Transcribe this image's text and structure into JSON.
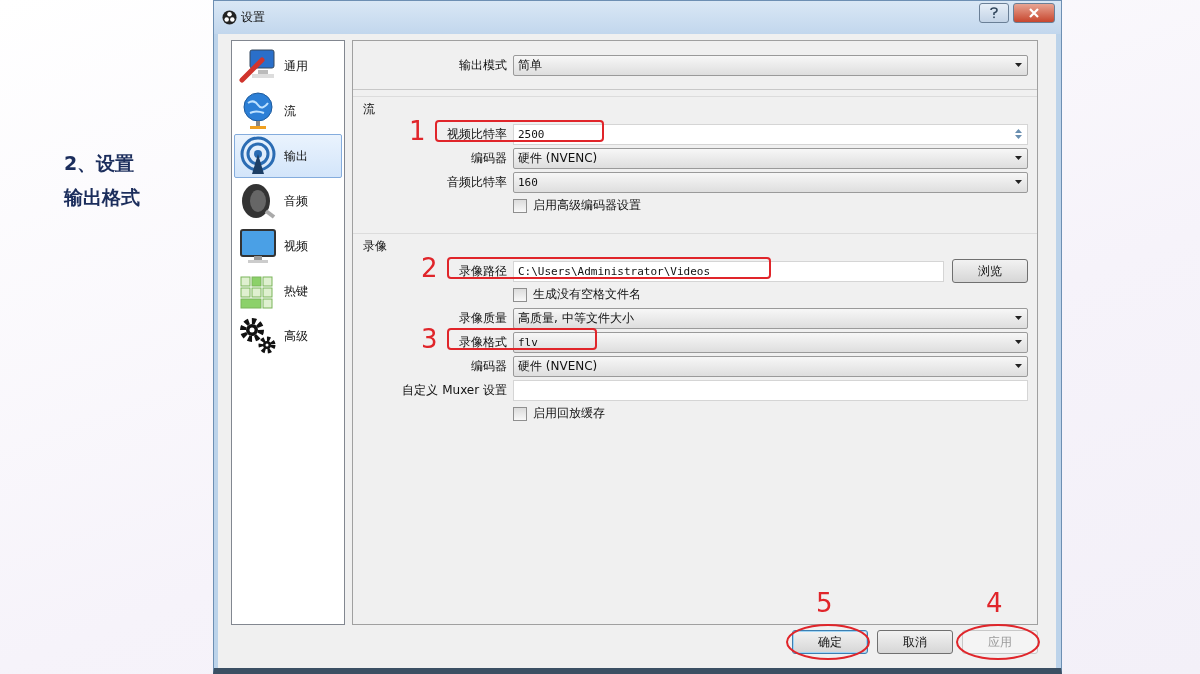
{
  "slide": {
    "caption_lines": [
      "2、设置",
      "输出格式"
    ]
  },
  "window": {
    "title": "设置"
  },
  "sidebar": {
    "items": [
      {
        "label": "通用",
        "kind": "general",
        "selected": false
      },
      {
        "label": "流",
        "kind": "stream",
        "selected": false
      },
      {
        "label": "输出",
        "kind": "output",
        "selected": true
      },
      {
        "label": "音频",
        "kind": "audio",
        "selected": false
      },
      {
        "label": "视频",
        "kind": "video",
        "selected": false
      },
      {
        "label": "热键",
        "kind": "hotkeys",
        "selected": false
      },
      {
        "label": "高级",
        "kind": "advanced",
        "selected": false
      }
    ]
  },
  "output_mode": {
    "label": "输出模式",
    "value": "简单"
  },
  "groups": [
    {
      "title": "流",
      "rows": [
        {
          "kind": "spin",
          "label": "视频比特率",
          "value": "2500",
          "marker": "1"
        },
        {
          "kind": "combo",
          "label": "编码器",
          "value": "硬件 (NVENC)"
        },
        {
          "kind": "combo",
          "label": "音频比特率",
          "value": "160"
        },
        {
          "kind": "checkbox",
          "label": "启用高级编码器设置",
          "checked": false
        }
      ]
    },
    {
      "title": "录像",
      "rows": [
        {
          "kind": "path",
          "label": "录像路径",
          "value": "C:\\Users\\Administrator\\Videos",
          "button": "浏览",
          "marker": "2"
        },
        {
          "kind": "checkbox",
          "label": "生成没有空格文件名",
          "checked": false
        },
        {
          "kind": "combo",
          "label": "录像质量",
          "value": "高质量, 中等文件大小"
        },
        {
          "kind": "combo",
          "label": "录像格式",
          "value": "flv",
          "marker": "3"
        },
        {
          "kind": "combo",
          "label": "编码器",
          "value": "硬件 (NVENC)"
        },
        {
          "kind": "text",
          "label": "自定义 Muxer 设置",
          "value": ""
        },
        {
          "kind": "checkbox",
          "label": "启用回放缓存",
          "checked": false
        }
      ]
    }
  ],
  "buttons": [
    {
      "label": "确定",
      "focused": true,
      "disabled": false,
      "marker": "5"
    },
    {
      "label": "取消",
      "focused": false,
      "disabled": false
    },
    {
      "label": "应用",
      "focused": false,
      "disabled": true,
      "marker": "4"
    }
  ]
}
